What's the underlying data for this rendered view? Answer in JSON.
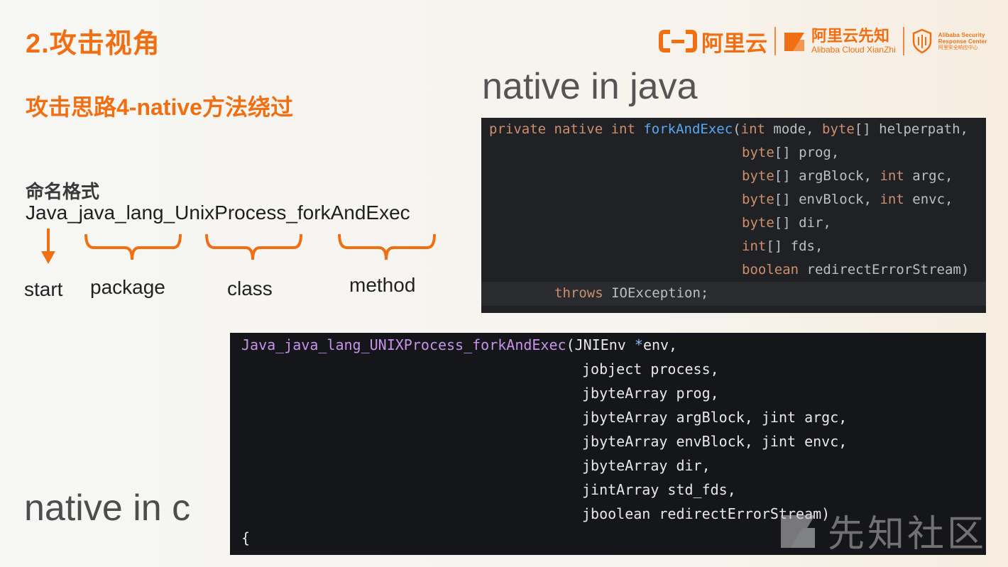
{
  "slide": {
    "title": "2.攻击视角",
    "subtitle": "攻击思路4-native方法绕过",
    "naming_format_label": "命名格式",
    "naming_example": "Java_java_lang_UnixProcess_forkAndExec",
    "segments": {
      "start": "start",
      "package": "package",
      "class": "class",
      "method": "method"
    },
    "native_java_heading": "native in java",
    "native_c_heading": "native in c"
  },
  "logos": {
    "aliyun": "阿里云",
    "xianzhi_cn": "阿里云先知",
    "xianzhi_en": "Alibaba Cloud XianZhi",
    "asrc_en_line1": "Alibaba Security",
    "asrc_en_line2": "Response Center",
    "asrc_cn": "阿里安全响应中心",
    "brand_color": "#f06f12"
  },
  "java_code": {
    "l1_kw": "private native int ",
    "l1_fn": "forkAndExec",
    "l1_rest_a": "(",
    "l1_kw2": "int",
    "l1_rest_b": " mode, ",
    "l1_kw3": "byte",
    "l1_rest_c": "[] helperpath,",
    "l2_kw": "byte",
    "l2_rest": "[] prog,",
    "l3_kw": "byte",
    "l3_rest_a": "[] argBlock, ",
    "l3_kw2": "int",
    "l3_rest_b": " argc,",
    "l4_kw": "byte",
    "l4_rest_a": "[] envBlock, ",
    "l4_kw2": "int",
    "l4_rest_b": " envc,",
    "l5_kw": "byte",
    "l5_rest": "[] dir,",
    "l6_kw": "int",
    "l6_rest": "[] fds,",
    "l7_kw": "boolean",
    "l7_rest": " redirectErrorStream)",
    "l8_kw": "throws",
    "l8_rest": " IOException;"
  },
  "c_code": {
    "l1_fn": "Java_java_lang_UNIXProcess_forkAndExec",
    "l1_rest_a": "(JNIEnv ",
    "l1_op": "*",
    "l1_rest_b": "env,",
    "l2": "jobject process,",
    "l3": "jbyteArray prog,",
    "l4": "jbyteArray argBlock, jint argc,",
    "l5": "jbyteArray envBlock, jint envc,",
    "l6": "jbyteArray dir,",
    "l7": "jintArray std_fds,",
    "l8": "jboolean redirectErrorStream)",
    "l9": "{"
  },
  "watermark": "先知社区"
}
